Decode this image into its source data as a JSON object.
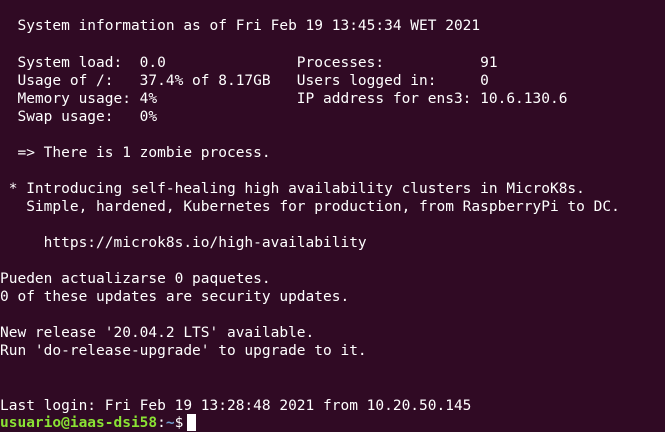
{
  "colors": {
    "background": "#300a24",
    "text": "#ffffff",
    "prompt_user": "#8ae234",
    "prompt_path": "#729fcf"
  },
  "output": {
    "sysinfo_title": "  System information as of Fri Feb 19 13:45:34 WET 2021",
    "stats_row1": "  System load:  0.0               Processes:           91",
    "stats_row2": "  Usage of /:   37.4% of 8.17GB   Users logged in:     0",
    "stats_row3": "  Memory usage: 4%                IP address for ens3: 10.6.130.6",
    "stats_row4": "  Swap usage:   0%",
    "zombie": "  => There is 1 zombie process.",
    "microk8s_line1": " * Introducing self-healing high availability clusters in MicroK8s.",
    "microk8s_line2": "   Simple, hardened, Kubernetes for production, from RaspberryPi to DC.",
    "microk8s_url": "     https://microk8s.io/high-availability",
    "updates_line1": "Pueden actualizarse 0 paquetes.",
    "updates_line2": "0 of these updates are security updates.",
    "release_line1": "New release '20.04.2 LTS' available.",
    "release_line2": "Run 'do-release-upgrade' to upgrade to it.",
    "last_login": "Last login: Fri Feb 19 13:28:48 2021 from 10.20.50.145"
  },
  "prompt": {
    "user_host": "usuario@iaas-dsi58",
    "separator": ":",
    "path": "~",
    "symbol": "$"
  }
}
